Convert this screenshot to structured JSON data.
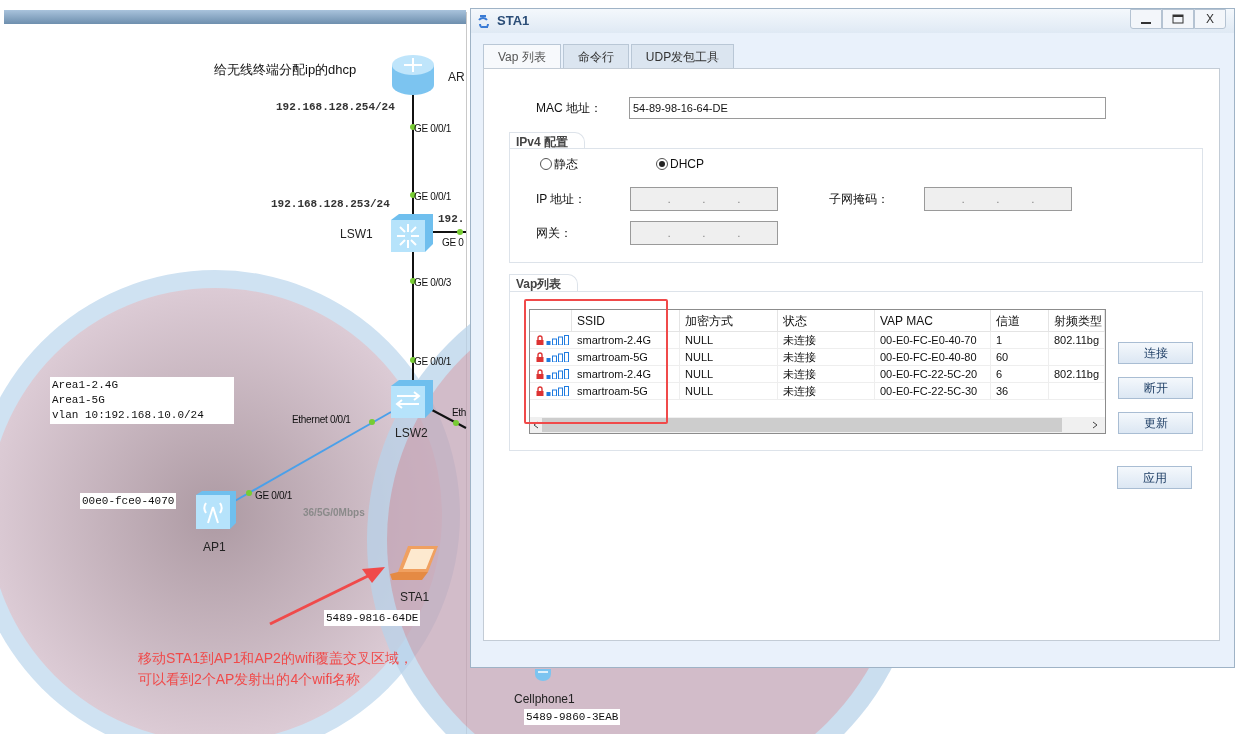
{
  "dhcp_note": "给无线终端分配ip的dhcp",
  "devices": [
    {
      "name": "AR",
      "kind": "router"
    },
    {
      "name": "LSW1",
      "kind": "core_switch"
    },
    {
      "name": "LSW2",
      "kind": "switch"
    },
    {
      "name": "AP1",
      "kind": "ap"
    },
    {
      "name": "STA1",
      "kind": "laptop"
    },
    {
      "name": "Cellphone1",
      "kind": "phone"
    }
  ],
  "ip_labels": [
    "192.168.128.254/24",
    "192.168.128.253/24",
    "192."
  ],
  "ports": [
    "GE 0/0/1",
    "GE 0/0/1",
    "GE 0",
    "GE 0/0/3",
    "GE 0/0/1",
    "Ethernet 0/0/1",
    "Eth",
    "GE 0/0/1"
  ],
  "link_rate": "36/5G/0Mbps",
  "area_note": [
    "Area1-2.4G",
    "Area1-5G",
    "vlan 10:192.168.10.0/24"
  ],
  "mac_tags": [
    "00e0-fce0-4070",
    "5489-9816-64DE",
    "5489-9860-3EAB"
  ],
  "annotation": [
    "移动STA1到AP1和AP2的wifi覆盖交叉区域，",
    "可以看到2个AP发射出的4个wifi名称"
  ],
  "window": {
    "title": "STA1",
    "close_label": "X"
  },
  "tabs": [
    {
      "label": "Vap 列表",
      "selected": true
    },
    {
      "label": "命令行",
      "selected": false
    },
    {
      "label": "UDP发包工具",
      "selected": false
    }
  ],
  "mac": {
    "label": "MAC 地址：",
    "value": "54-89-98-16-64-DE"
  },
  "ipv4": {
    "title": "IPv4 配置",
    "modes": [
      {
        "label": "静态",
        "selected": false
      },
      {
        "label": "DHCP",
        "selected": true
      }
    ],
    "fields": [
      {
        "label": "IP 地址：",
        "separators": [
          ".",
          ".",
          "."
        ],
        "disabled": true
      },
      {
        "label": "子网掩码：",
        "separators": [
          ".",
          ".",
          "."
        ],
        "disabled": true
      },
      {
        "label": "网关：",
        "separators": [
          ".",
          ".",
          "."
        ],
        "disabled": true
      }
    ]
  },
  "vap": {
    "title": "Vap列表",
    "columns": [
      "SSID",
      "加密方式",
      "状态",
      "VAP MAC",
      "信道",
      "射频类型"
    ],
    "rows": [
      {
        "ssid": "smartrom-2.4G",
        "encryption": "NULL",
        "status": "未连接",
        "mac": "00-E0-FC-E0-40-70",
        "channel": "1",
        "radio": "802.11bg"
      },
      {
        "ssid": "smartroam-5G",
        "encryption": "NULL",
        "status": "未连接",
        "mac": "00-E0-FC-E0-40-80",
        "channel": "60",
        "radio": ""
      },
      {
        "ssid": "smartrom-2.4G",
        "encryption": "NULL",
        "status": "未连接",
        "mac": "00-E0-FC-22-5C-20",
        "channel": "6",
        "radio": "802.11bg"
      },
      {
        "ssid": "smartroam-5G",
        "encryption": "NULL",
        "status": "未连接",
        "mac": "00-E0-FC-22-5C-30",
        "channel": "36",
        "radio": ""
      }
    ],
    "buttons": [
      "连接",
      "断开",
      "更新"
    ]
  },
  "apply": "应用"
}
